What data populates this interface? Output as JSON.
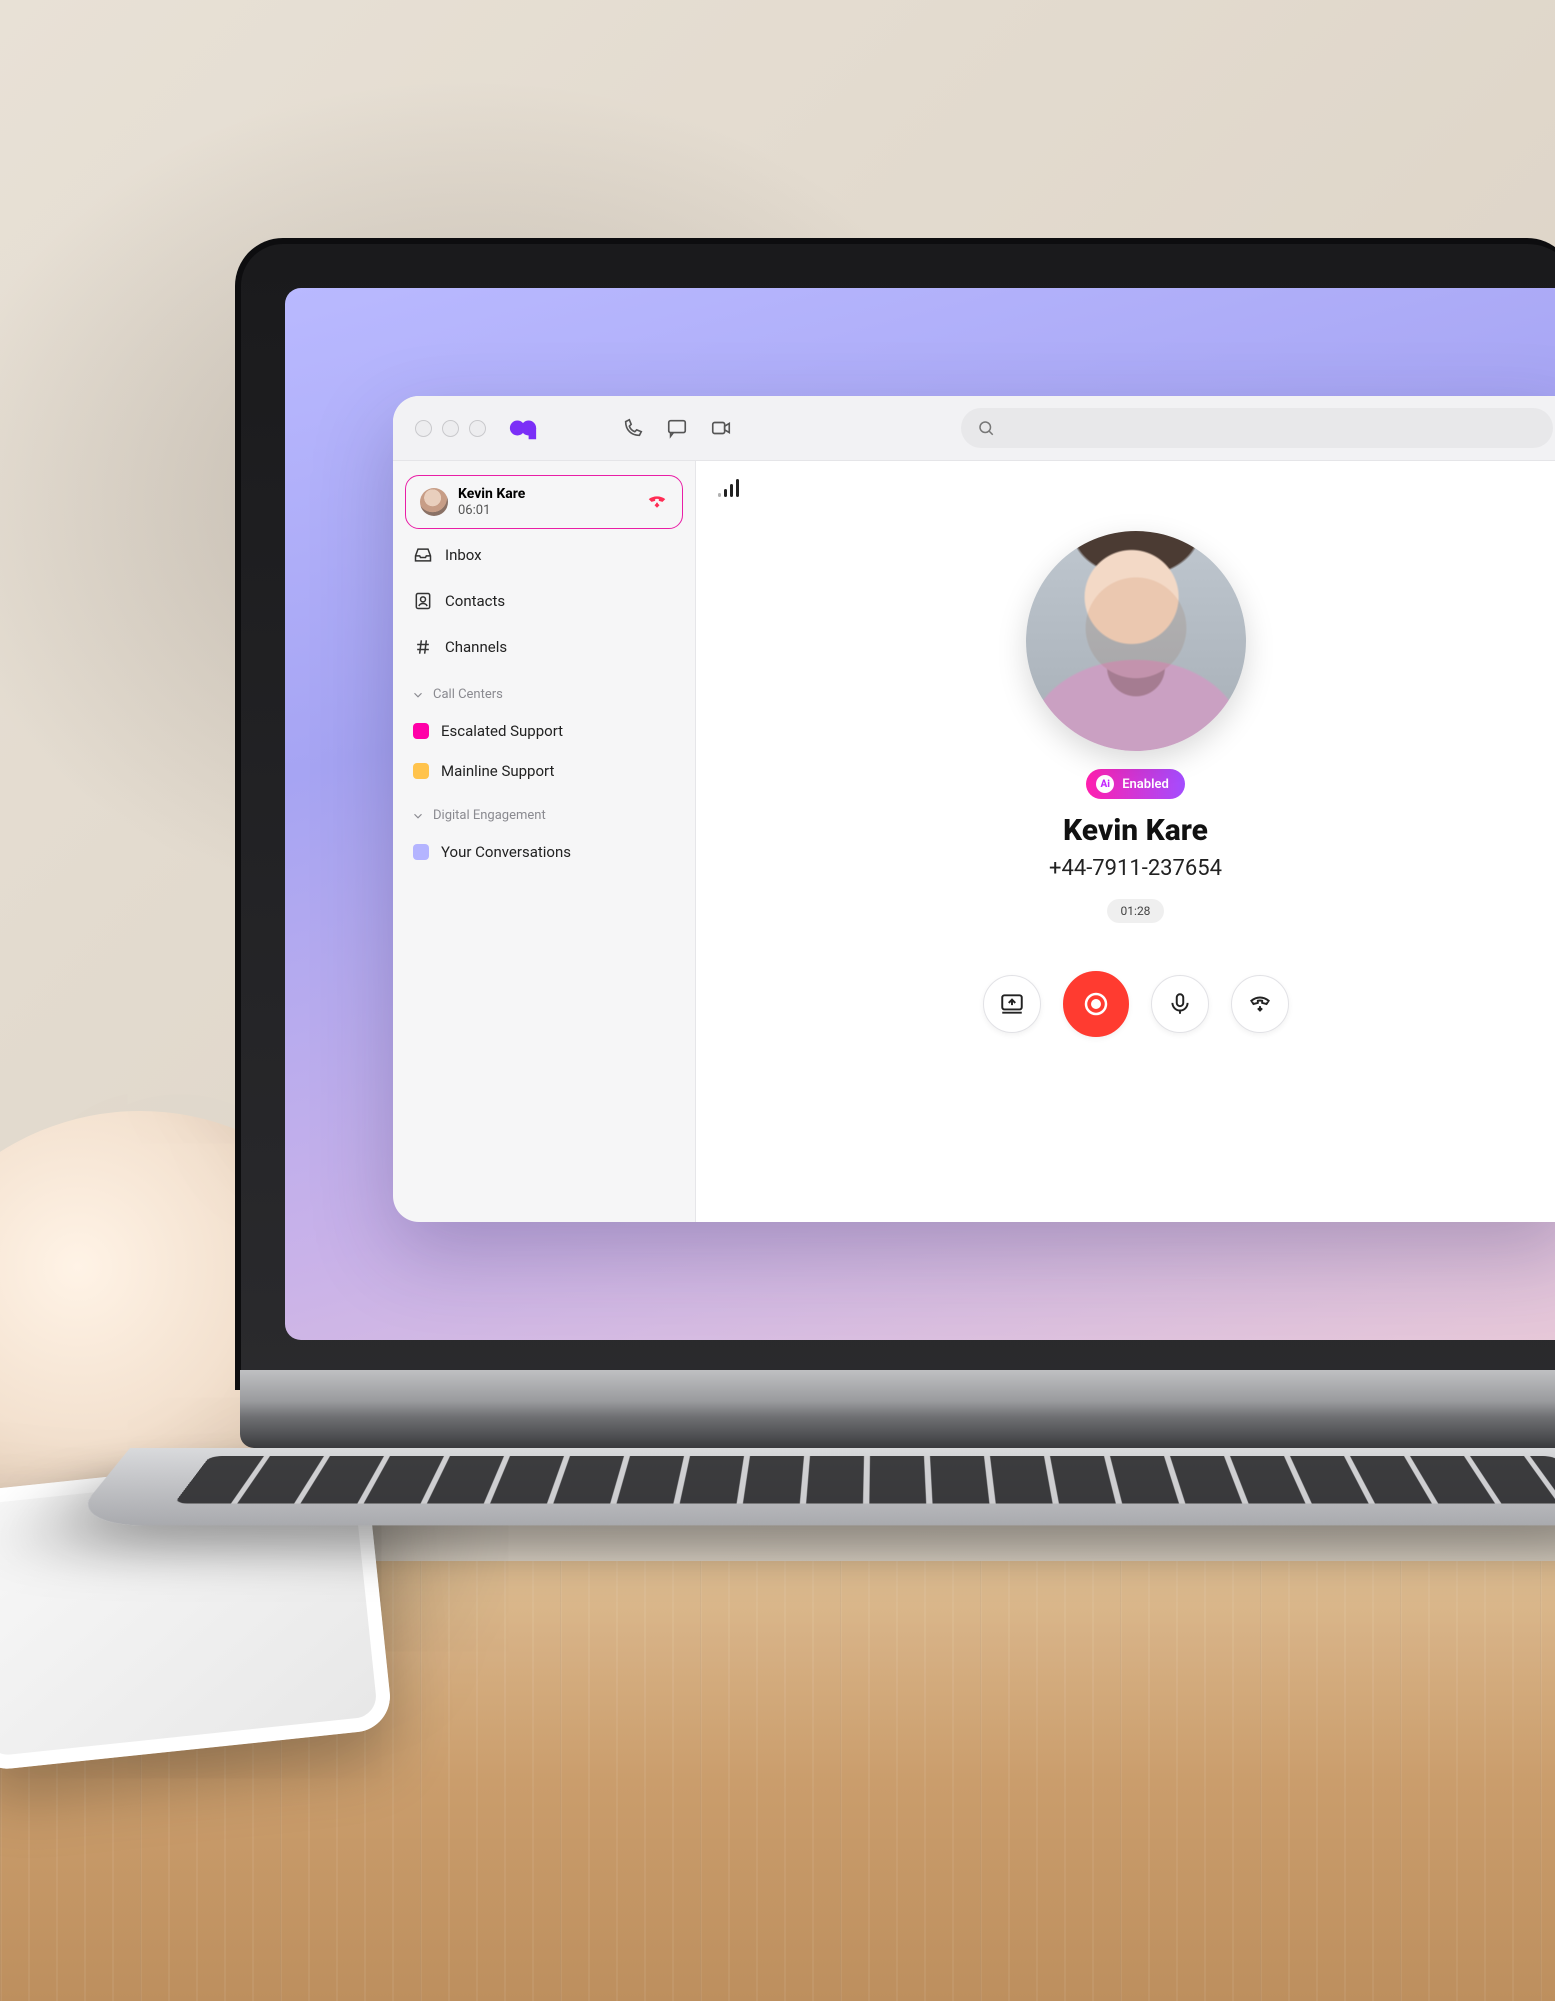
{
  "titlebar": {
    "search_placeholder": ""
  },
  "sidebar": {
    "active_call": {
      "name": "Kevin Kare",
      "duration": "06:01"
    },
    "nav": {
      "inbox": "Inbox",
      "contacts": "Contacts",
      "channels": "Channels"
    },
    "sections": {
      "call_centers": {
        "label": "Call Centers",
        "items": [
          {
            "label": "Escalated Support",
            "color": "pink"
          },
          {
            "label": "Mainline Support",
            "color": "amber"
          }
        ]
      },
      "digital_engagement": {
        "label": "Digital Engagement",
        "items": [
          {
            "label": "Your Conversations",
            "color": "lilac"
          }
        ]
      }
    }
  },
  "call": {
    "ai_label": "Enabled",
    "caller_name": "Kevin Kare",
    "caller_phone": "+44-7911-237654",
    "timer": "01:28"
  }
}
